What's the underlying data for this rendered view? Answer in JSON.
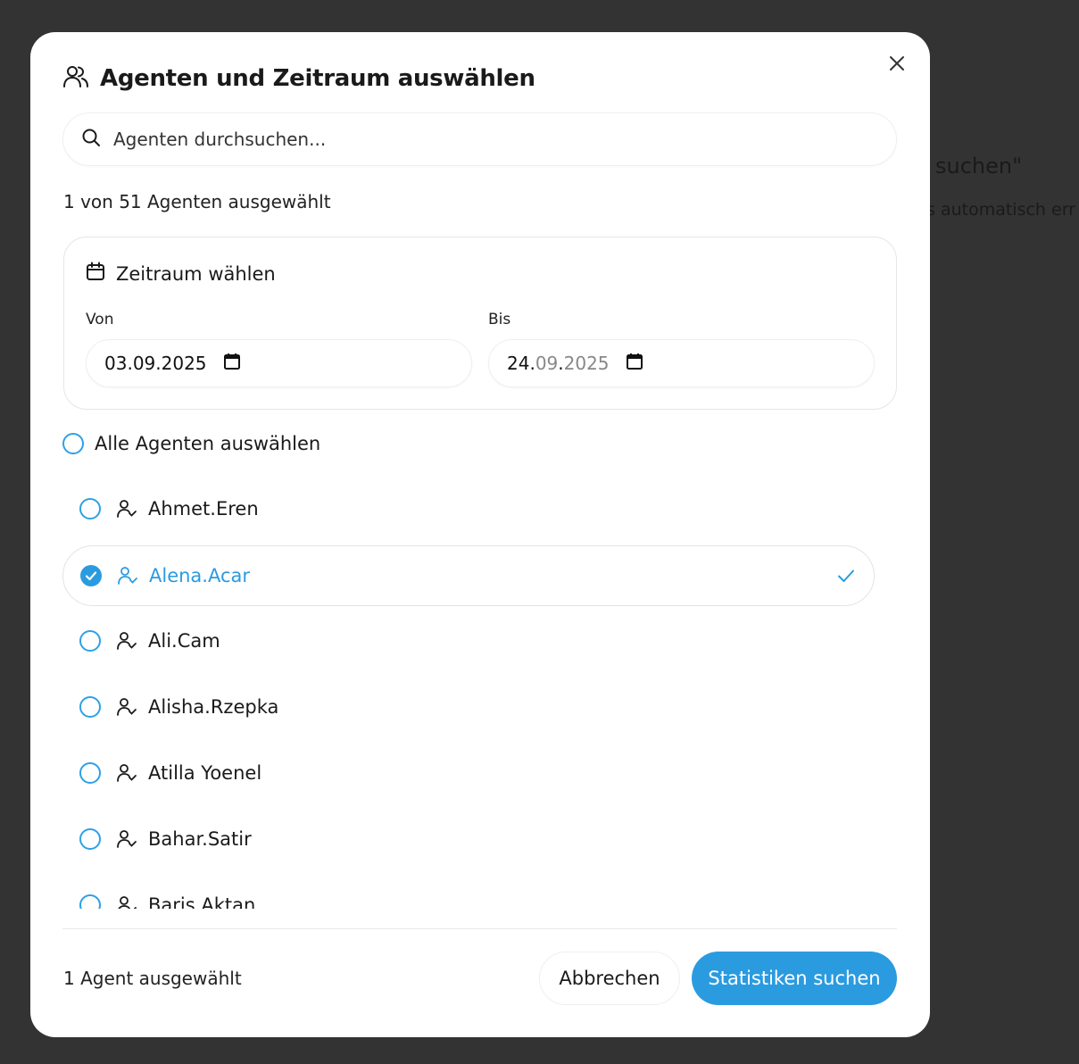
{
  "background": {
    "text_1": "suchen\"",
    "text_2": "s automatisch err"
  },
  "dialog": {
    "title": "Agenten und Zeitraum auswählen",
    "search": {
      "placeholder": "Agenten durchsuchen..."
    },
    "selection_summary": "1 von 51 Agenten ausgewählt",
    "date_range": {
      "heading": "Zeitraum wählen",
      "from_label": "Von",
      "from_value": {
        "day": "03",
        "sep1": ".",
        "month": "09",
        "sep2": ".",
        "year": "2025"
      },
      "to_label": "Bis",
      "to_value": {
        "day": "24",
        "sep1": ".",
        "month": "09",
        "sep2": ".",
        "year": "2025"
      }
    },
    "select_all_label": "Alle Agenten auswählen",
    "agents": [
      {
        "name": "Ahmet.Eren",
        "selected": false
      },
      {
        "name": "Alena.Acar",
        "selected": true
      },
      {
        "name": "Ali.Cam",
        "selected": false
      },
      {
        "name": "Alisha.Rzepka",
        "selected": false
      },
      {
        "name": "Atilla Yoenel",
        "selected": false
      },
      {
        "name": "Bahar.Satir",
        "selected": false
      },
      {
        "name": "Baris.Aktan",
        "selected": false
      }
    ],
    "footer": {
      "count_label": "1 Agent ausgewählt",
      "cancel_label": "Abbrechen",
      "submit_label": "Statistiken suchen"
    },
    "colors": {
      "accent": "#2b9be0",
      "overlay": "#333333"
    }
  }
}
